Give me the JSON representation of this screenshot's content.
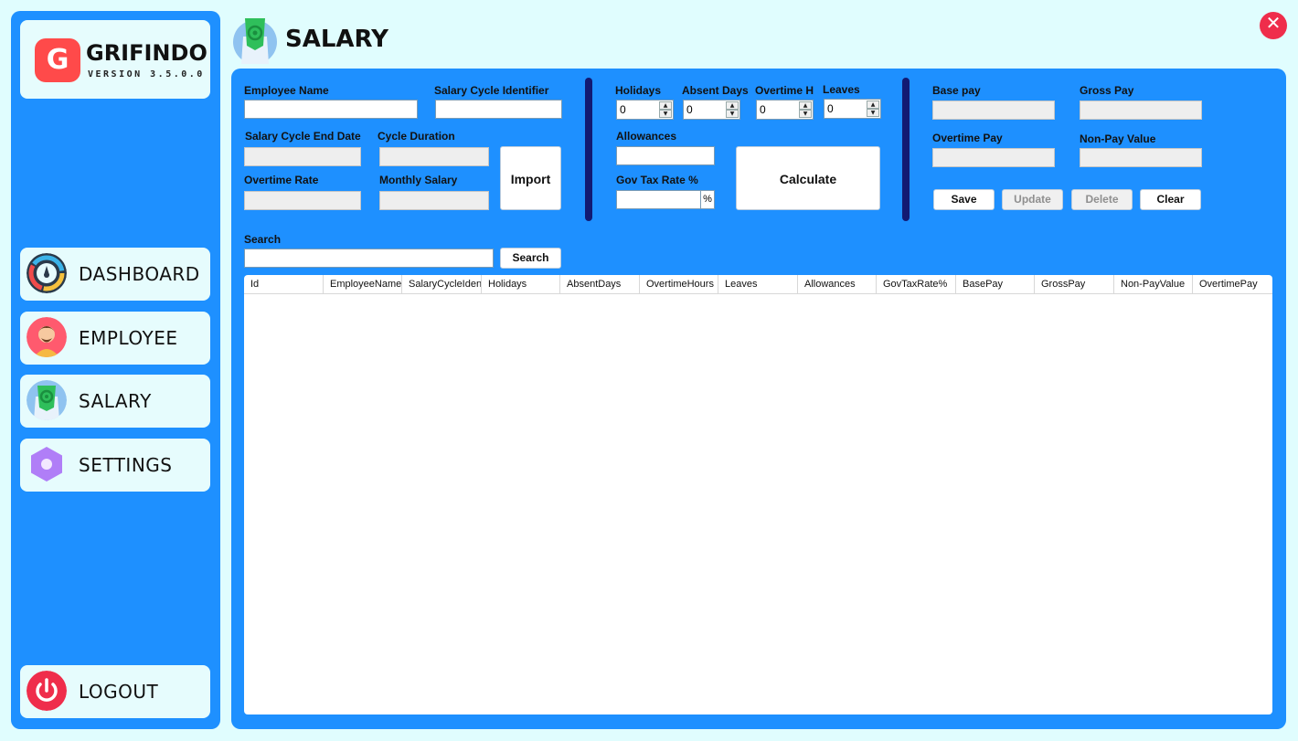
{
  "app": {
    "name": "GRIFINDO",
    "version": "VERSION 3.5.0.0",
    "logo_letter": "G"
  },
  "sidebar": {
    "items": [
      {
        "label": "DASHBOARD",
        "icon": "gauge-icon"
      },
      {
        "label": "EMPLOYEE",
        "icon": "person-avatar-icon"
      },
      {
        "label": "SALARY",
        "icon": "money-icon"
      },
      {
        "label": "SETTINGS",
        "icon": "hexagon-settings-icon"
      }
    ],
    "logout": {
      "label": "LOGOUT",
      "icon": "power-icon"
    }
  },
  "header": {
    "title": "SALARY",
    "close_glyph": "✕"
  },
  "form": {
    "employee_name": {
      "label": "Employee Name",
      "value": ""
    },
    "salary_cycle_identifier": {
      "label": "Salary Cycle Identifier",
      "value": ""
    },
    "salary_cycle_end_date": {
      "label": "Salary Cycle End Date",
      "value": ""
    },
    "cycle_duration": {
      "label": "Cycle Duration",
      "value": ""
    },
    "overtime_rate": {
      "label": "Overtime Rate",
      "value": ""
    },
    "monthly_salary": {
      "label": "Monthly Salary",
      "value": ""
    },
    "import_button": "Import",
    "holidays": {
      "label": "Holidays",
      "value": "0"
    },
    "absent_days": {
      "label": "Absent Days",
      "value": "0"
    },
    "overtime_h": {
      "label": "Overtime H",
      "value": "0"
    },
    "leaves": {
      "label": "Leaves",
      "value": "0"
    },
    "allowances": {
      "label": "Allowances",
      "value": ""
    },
    "gov_tax_rate": {
      "label": "Gov Tax Rate %",
      "value": "",
      "suffix": "%"
    },
    "calculate_button": "Calculate",
    "base_pay": {
      "label": "Base pay",
      "value": ""
    },
    "gross_pay": {
      "label": "Gross Pay",
      "value": ""
    },
    "overtime_pay": {
      "label": "Overtime Pay",
      "value": ""
    },
    "non_pay_value": {
      "label": "Non-Pay Value",
      "value": ""
    },
    "save_button": "Save",
    "update_button": "Update",
    "delete_button": "Delete",
    "clear_button": "Clear"
  },
  "search": {
    "label": "Search",
    "value": "",
    "button": "Search"
  },
  "table": {
    "columns": [
      "Id",
      "EmployeeName",
      "SalaryCycleIdent",
      "Holidays",
      "AbsentDays",
      "OvertimeHours",
      "Leaves",
      "Allowances",
      "GovTaxRate%",
      "BasePay",
      "GrossPay",
      "Non-PayValue",
      "OvertimePay"
    ],
    "rows": []
  },
  "colors": {
    "background": "#e0fdfe",
    "panel": "#1e90ff",
    "divider": "#121a73",
    "close": "#ef2d4b",
    "logo": "#ff4a4a"
  }
}
